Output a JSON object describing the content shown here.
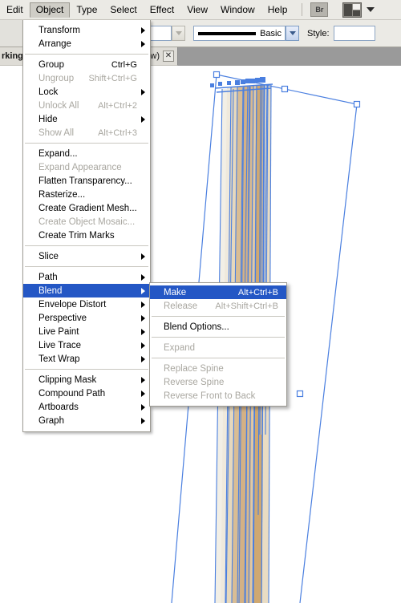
{
  "menubar": {
    "items": [
      {
        "label": "Edit",
        "active": false
      },
      {
        "label": "Object",
        "active": true
      },
      {
        "label": "Type",
        "active": false
      },
      {
        "label": "Select",
        "active": false
      },
      {
        "label": "Effect",
        "active": false
      },
      {
        "label": "View",
        "active": false
      },
      {
        "label": "Window",
        "active": false
      },
      {
        "label": "Help",
        "active": false
      }
    ],
    "bridge_label": "Br"
  },
  "controlbar": {
    "stroke_profile_label": "Basic",
    "style_label": "Style:",
    "fill_value": "",
    "style_value": ""
  },
  "document_tab": {
    "title": "rking",
    "title_suffix": "w)",
    "close_label": "✕"
  },
  "object_menu": {
    "groups": [
      [
        {
          "label": "Transform",
          "accel": "",
          "submenu": true,
          "disabled": false
        },
        {
          "label": "Arrange",
          "accel": "",
          "submenu": true,
          "disabled": false
        }
      ],
      [
        {
          "label": "Group",
          "accel": "Ctrl+G",
          "submenu": false,
          "disabled": false
        },
        {
          "label": "Ungroup",
          "accel": "Shift+Ctrl+G",
          "submenu": false,
          "disabled": true
        },
        {
          "label": "Lock",
          "accel": "",
          "submenu": true,
          "disabled": false
        },
        {
          "label": "Unlock All",
          "accel": "Alt+Ctrl+2",
          "submenu": false,
          "disabled": true
        },
        {
          "label": "Hide",
          "accel": "",
          "submenu": true,
          "disabled": false
        },
        {
          "label": "Show All",
          "accel": "Alt+Ctrl+3",
          "submenu": false,
          "disabled": true
        }
      ],
      [
        {
          "label": "Expand...",
          "accel": "",
          "submenu": false,
          "disabled": false
        },
        {
          "label": "Expand Appearance",
          "accel": "",
          "submenu": false,
          "disabled": true
        },
        {
          "label": "Flatten Transparency...",
          "accel": "",
          "submenu": false,
          "disabled": false
        },
        {
          "label": "Rasterize...",
          "accel": "",
          "submenu": false,
          "disabled": false
        },
        {
          "label": "Create Gradient Mesh...",
          "accel": "",
          "submenu": false,
          "disabled": false
        },
        {
          "label": "Create Object Mosaic...",
          "accel": "",
          "submenu": false,
          "disabled": true
        },
        {
          "label": "Create Trim Marks",
          "accel": "",
          "submenu": false,
          "disabled": false
        }
      ],
      [
        {
          "label": "Slice",
          "accel": "",
          "submenu": true,
          "disabled": false
        }
      ],
      [
        {
          "label": "Path",
          "accel": "",
          "submenu": true,
          "disabled": false
        },
        {
          "label": "Blend",
          "accel": "",
          "submenu": true,
          "disabled": false,
          "highlight": true
        },
        {
          "label": "Envelope Distort",
          "accel": "",
          "submenu": true,
          "disabled": false
        },
        {
          "label": "Perspective",
          "accel": "",
          "submenu": true,
          "disabled": false
        },
        {
          "label": "Live Paint",
          "accel": "",
          "submenu": true,
          "disabled": false
        },
        {
          "label": "Live Trace",
          "accel": "",
          "submenu": true,
          "disabled": false
        },
        {
          "label": "Text Wrap",
          "accel": "",
          "submenu": true,
          "disabled": false
        }
      ],
      [
        {
          "label": "Clipping Mask",
          "accel": "",
          "submenu": true,
          "disabled": false
        },
        {
          "label": "Compound Path",
          "accel": "",
          "submenu": true,
          "disabled": false
        },
        {
          "label": "Artboards",
          "accel": "",
          "submenu": true,
          "disabled": false
        },
        {
          "label": "Graph",
          "accel": "",
          "submenu": true,
          "disabled": false
        }
      ]
    ]
  },
  "blend_submenu": {
    "groups": [
      [
        {
          "label": "Make",
          "accel": "Alt+Ctrl+B",
          "submenu": false,
          "disabled": false,
          "highlight": true
        },
        {
          "label": "Release",
          "accel": "Alt+Shift+Ctrl+B",
          "submenu": false,
          "disabled": true
        }
      ],
      [
        {
          "label": "Blend Options...",
          "accel": "",
          "submenu": false,
          "disabled": false
        }
      ],
      [
        {
          "label": "Expand",
          "accel": "",
          "submenu": false,
          "disabled": true
        }
      ],
      [
        {
          "label": "Replace Spine",
          "accel": "",
          "submenu": false,
          "disabled": true
        },
        {
          "label": "Reverse Spine",
          "accel": "",
          "submenu": false,
          "disabled": true
        },
        {
          "label": "Reverse Front to Back",
          "accel": "",
          "submenu": false,
          "disabled": true
        }
      ]
    ]
  },
  "colors": {
    "menu_highlight": "#2457c5",
    "path_blue": "#4a7fe0",
    "artwork_tan": "#d4b185",
    "artwork_cream": "#f2efe6",
    "chrome_bg": "#ebeae5",
    "tabstrip_bg": "#9a9a9a"
  }
}
